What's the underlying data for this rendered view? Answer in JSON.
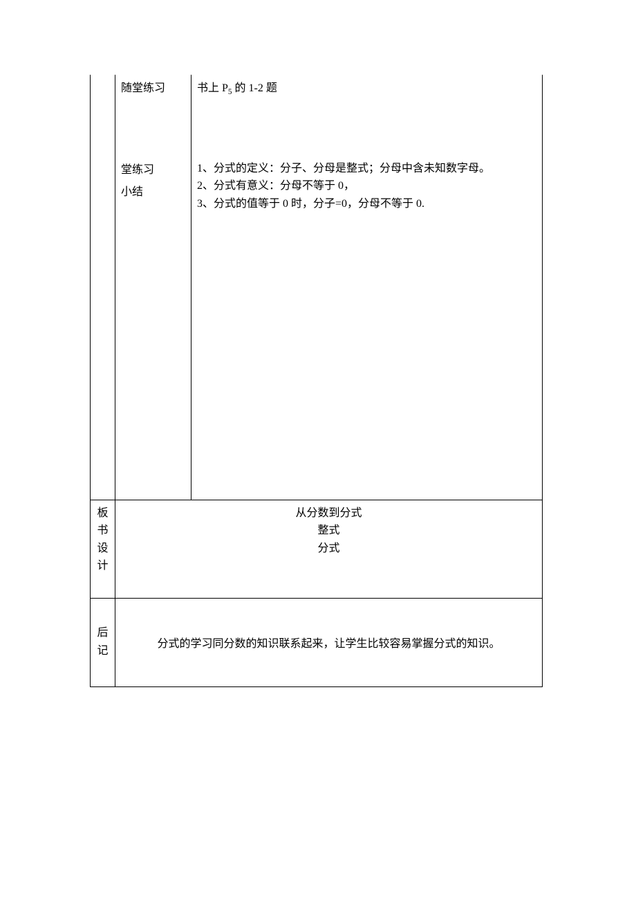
{
  "row1": {
    "label1": "随堂练习",
    "content1_pre": "书上 P",
    "content1_sub": "5",
    "content1_post": " 的 1-2 题",
    "label2a": "堂练习",
    "label2b": "小结",
    "summary1": "1、分式的定义：分子、分母是整式；分母中含未知数字母。",
    "summary2": "2、分式有意义：分母不等于 0，",
    "summary3": "3、分式的值等于 0 时，分子=0，分母不等于 0."
  },
  "row2": {
    "label_c1": "板",
    "label_c2": "书",
    "label_c3": "设",
    "label_c4": "计",
    "line1": "从分数到分式",
    "line2": "整式",
    "line3": "分式"
  },
  "row3": {
    "label_c1": "后",
    "label_c2": "记",
    "content": "分式的学习同分数的知识联系起来，让学生比较容易掌握分式的知识。"
  }
}
